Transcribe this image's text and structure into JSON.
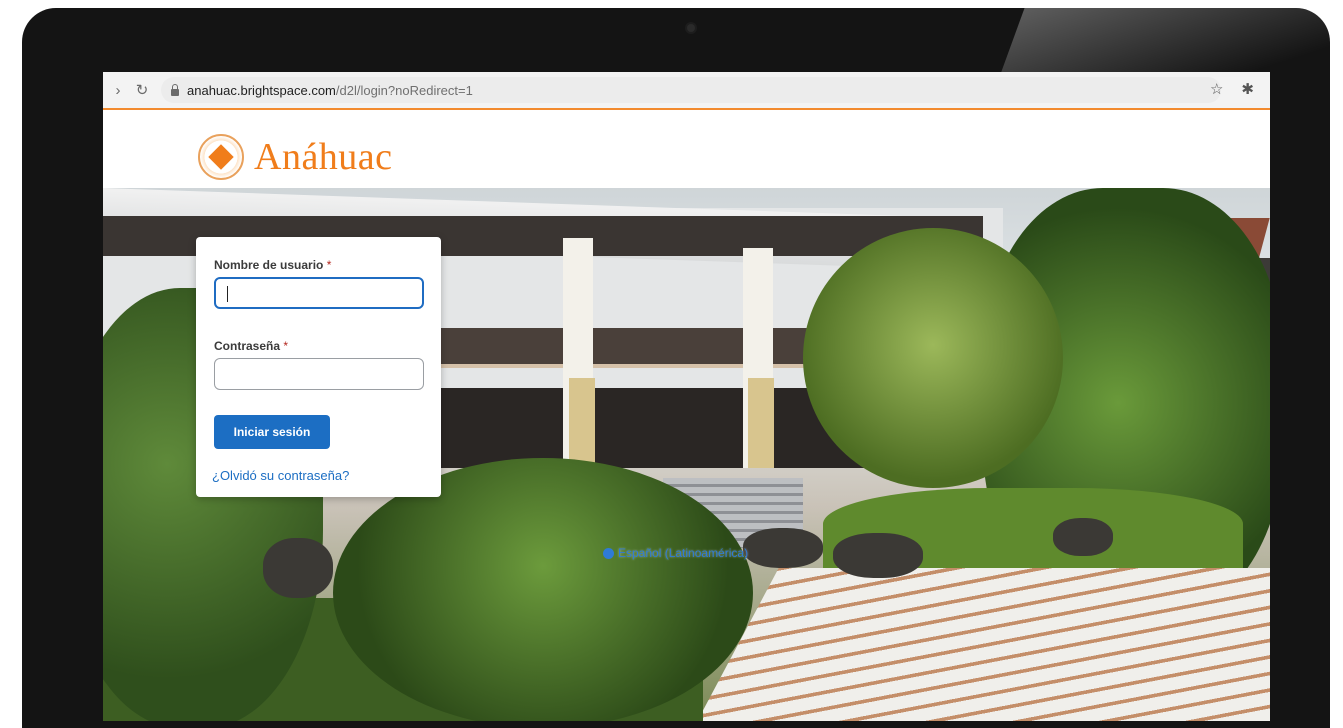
{
  "browser": {
    "url_host": "anahuac.brightspace.com",
    "url_path": "/d2l/login?noRedirect=1",
    "back_icon": "back-icon",
    "reload_icon": "reload-icon",
    "star_icon": "star-icon",
    "extensions_icon": "puzzle-icon"
  },
  "brand": {
    "name": "Anáhuac",
    "accent": "#f07d1b"
  },
  "login": {
    "username_label": "Nombre de usuario",
    "password_label": "Contraseña",
    "required_mark": "*",
    "submit_label": "Iniciar sesión",
    "forgot_link": "¿Olvidó su contraseña?",
    "button_color": "#1c6ec3"
  },
  "footer": {
    "language_link": "Español (Latinoamérica)"
  }
}
